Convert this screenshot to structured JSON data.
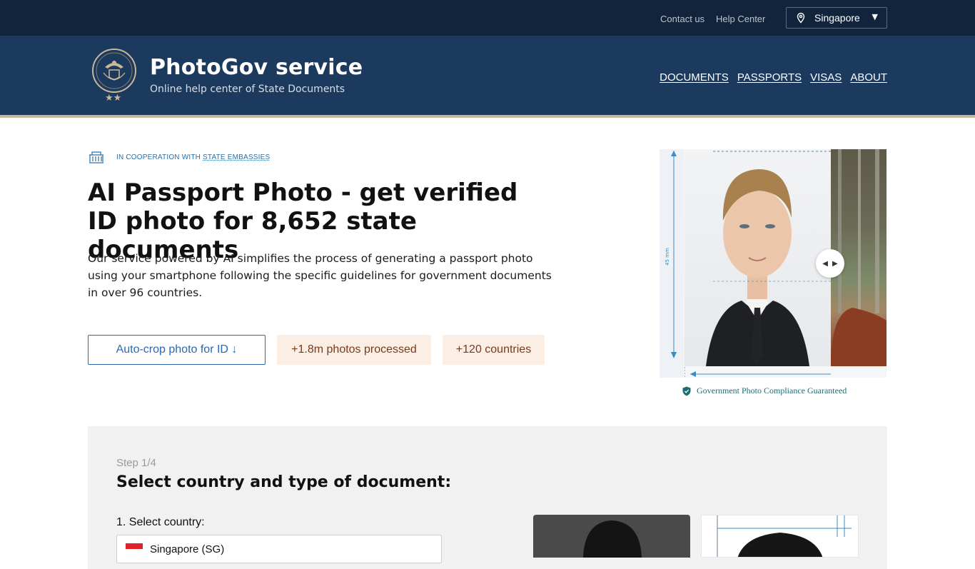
{
  "topbar": {
    "contact_label": "Contact us",
    "help_label": "Help Center",
    "country_label": "Singapore"
  },
  "header": {
    "brand_title": "PhotoGov service",
    "brand_subtitle": "Online help center of State Documents",
    "nav": [
      "DOCUMENTS",
      "PASSPORTS",
      "VISAS",
      "ABOUT"
    ]
  },
  "hero": {
    "coop_prefix": "IN COOPERATION WITH ",
    "coop_link": "STATE EMBASSIES",
    "title_bold": "AI Passport Photo",
    "title_rest": " - get verified ID photo for 8,652 state documents",
    "description": "Our service powered by AI simplifies the process of generating a passport photo using your smartphone following the specific guidelines for government documents in over 96 countries.",
    "crop_button": "Auto-crop photo for ID ↓",
    "stat_photos": "+1.8m photos processed",
    "stat_countries": "+120 countries",
    "ruler_label": "45 mm",
    "compliance": "Government Photo Compliance Guaranteed"
  },
  "step": {
    "number": "Step 1/4",
    "title": "Select country and type of document:",
    "select_country_label": "1. Select country:",
    "select_country_value": "Singapore (SG)"
  },
  "colors": {
    "topbar": "#11243b",
    "header": "#1c3a5e",
    "accent_blue": "#2c67b0",
    "stat_bg": "#fbefe5",
    "stat_text": "#7a3a1a",
    "compliance_teal": "#1f6b74"
  }
}
